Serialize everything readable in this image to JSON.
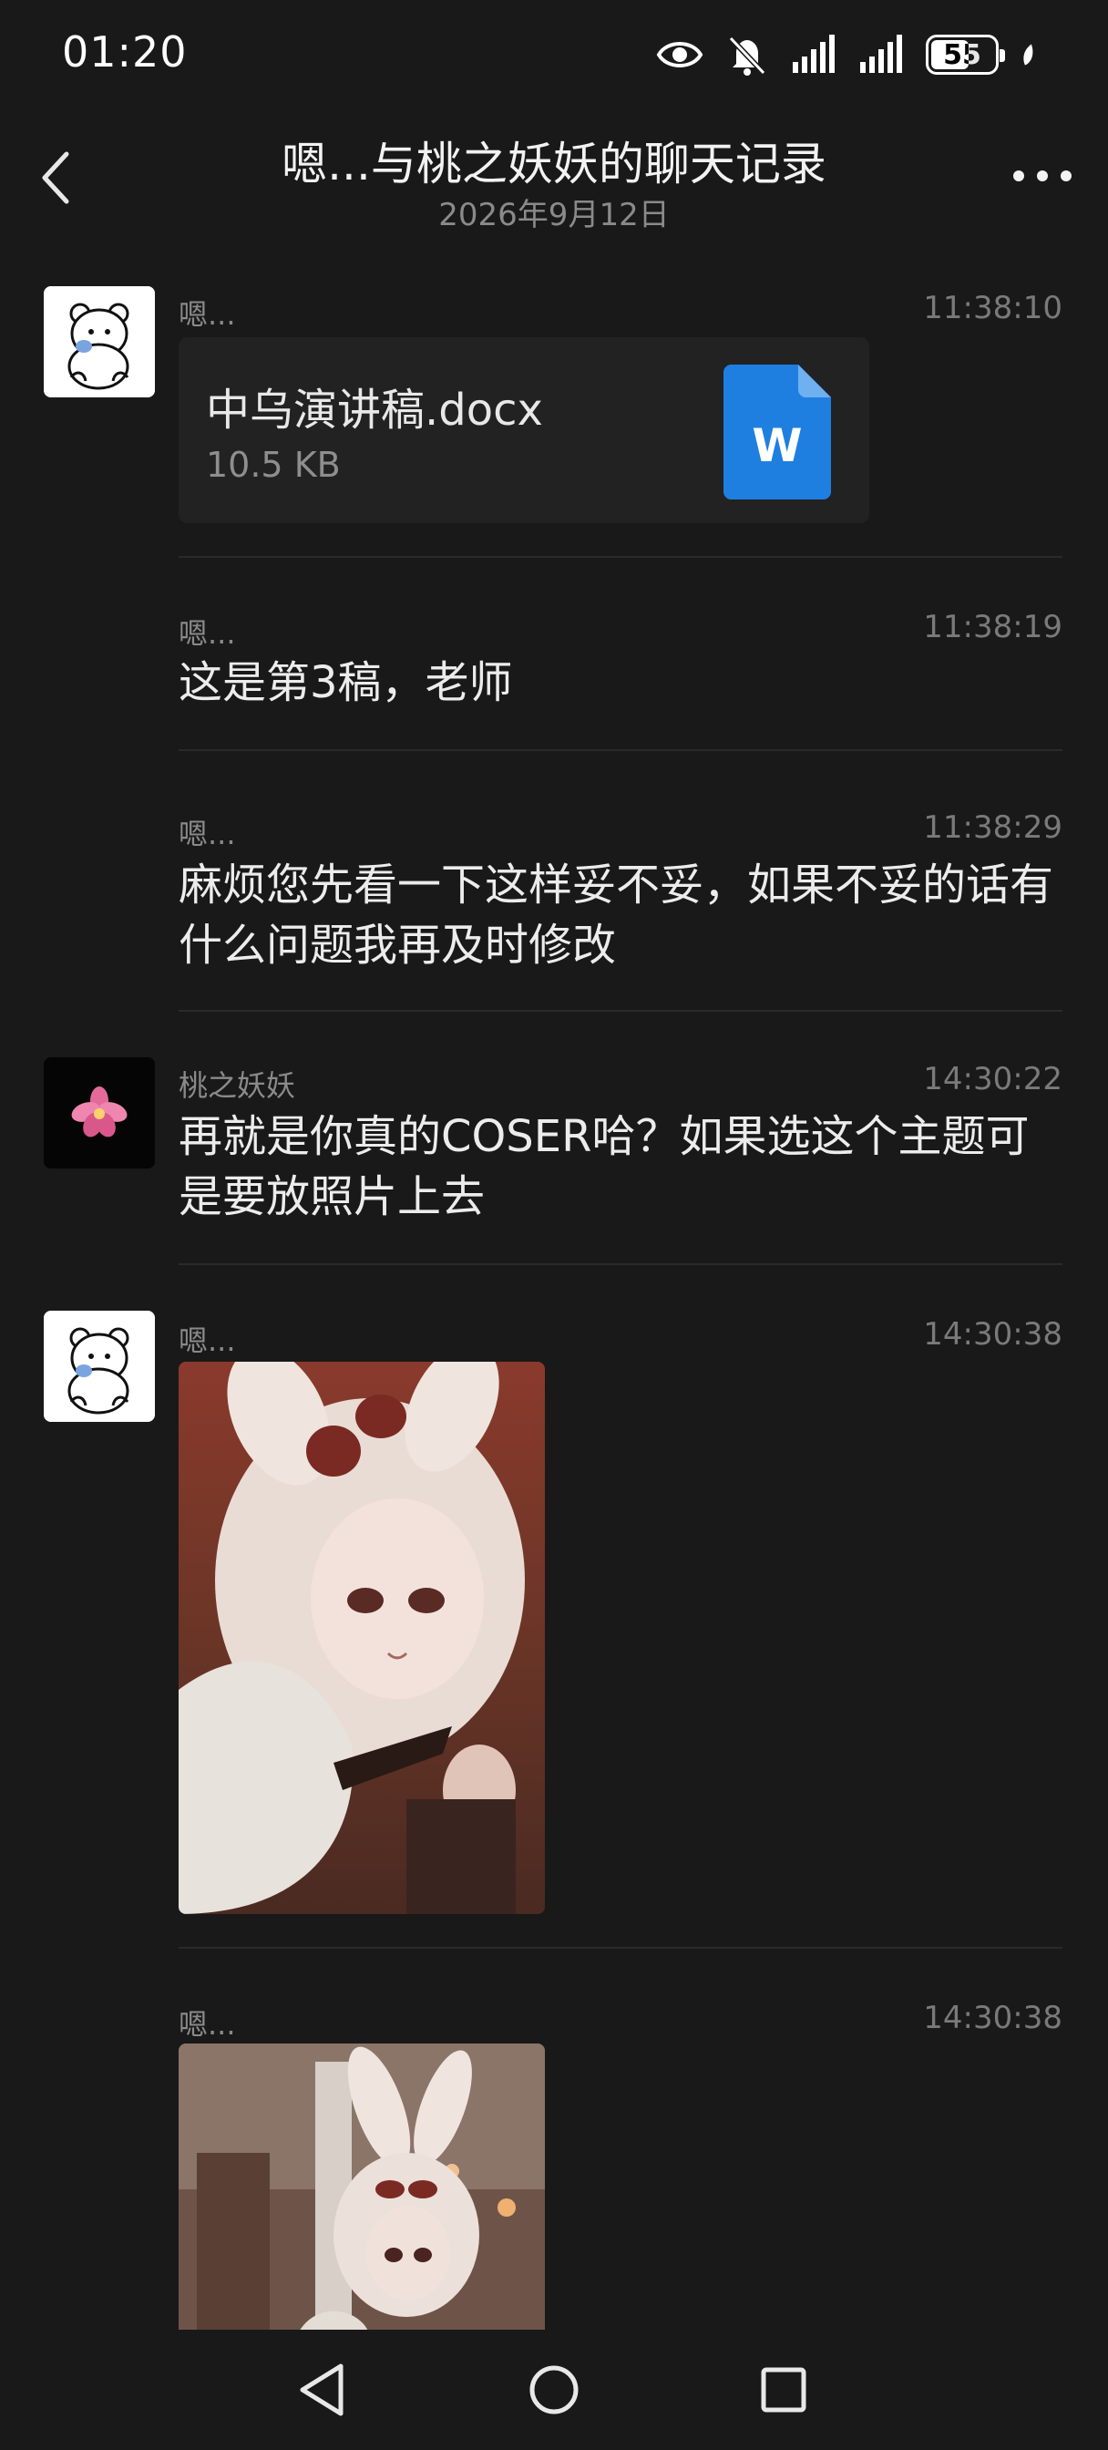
{
  "status_bar": {
    "time": "01:20",
    "battery_level": "55",
    "icons": [
      "eye-icon",
      "bell-off-icon",
      "signal-icon",
      "signal-icon",
      "battery-icon",
      "leaf-icon"
    ]
  },
  "header": {
    "title": "嗯...与桃之妖妖的聊天记录",
    "subtitle": "2026年9月12日"
  },
  "messages": [
    {
      "sender": "嗯...",
      "time": "11:38:10",
      "type": "file",
      "file_name": "中乌演讲稿.docx",
      "file_size": "10.5 KB",
      "file_icon_letter": "W"
    },
    {
      "sender": "嗯...",
      "time": "11:38:19",
      "type": "text",
      "text": "这是第3稿，老师"
    },
    {
      "sender": "嗯...",
      "time": "11:38:29",
      "type": "text",
      "text": "麻烦您先看一下这样妥不妥，如果不妥的话有什么问题我再及时修改"
    },
    {
      "sender": "桃之妖妖",
      "time": "14:30:22",
      "type": "text",
      "text": "再就是你真的COSER哈？如果选这个主题可是要放照片上去"
    },
    {
      "sender": "嗯...",
      "time": "14:30:38",
      "type": "image"
    },
    {
      "sender": "嗯...",
      "time": "14:30:38",
      "type": "image"
    }
  ],
  "colors": {
    "background": "#191919",
    "word_blue": "#1e7fe0"
  }
}
